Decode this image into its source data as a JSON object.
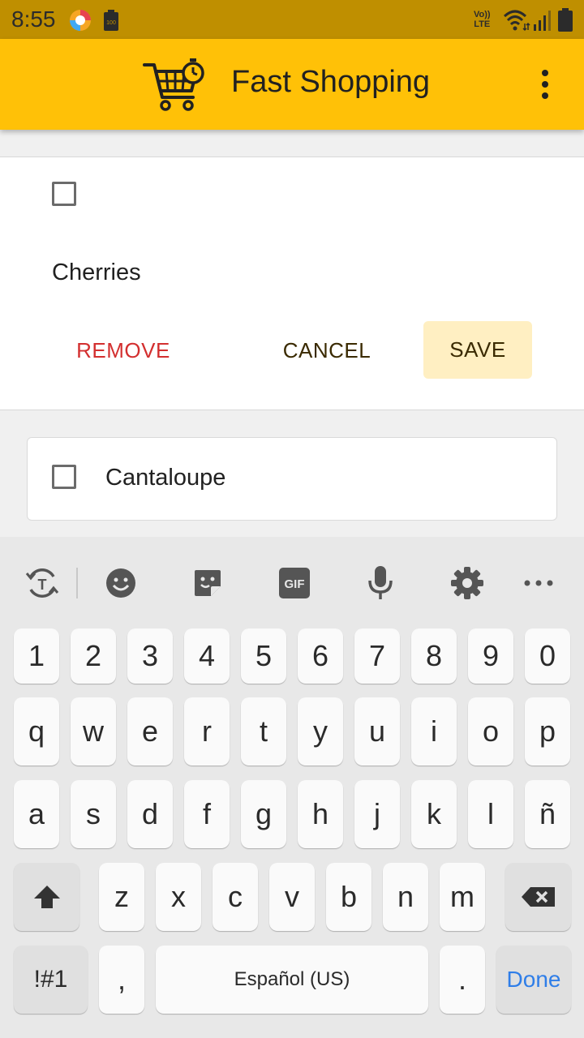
{
  "status_bar": {
    "time": "8:55",
    "volte_top": "Vo))",
    "volte_bottom": "LTE"
  },
  "app_bar": {
    "title": "Fast Shopping",
    "icons": [
      "cart-timer-icon",
      "more-vert-icon"
    ]
  },
  "edit_card": {
    "checked": false,
    "item_name": "Cherries",
    "remove_label": "REMOVE",
    "cancel_label": "CANCEL",
    "save_label": "SAVE"
  },
  "list": {
    "items": [
      {
        "label": "Cantaloupe",
        "checked": false
      }
    ]
  },
  "keyboard": {
    "toolbar_icons": [
      "translate-icon",
      "emoji-icon",
      "sticker-icon",
      "gif-icon",
      "microphone-icon",
      "settings-icon",
      "more-horiz-icon"
    ],
    "gif_label": "GIF",
    "row_numbers": [
      "1",
      "2",
      "3",
      "4",
      "5",
      "6",
      "7",
      "8",
      "9",
      "0"
    ],
    "row_1": [
      "q",
      "w",
      "e",
      "r",
      "t",
      "y",
      "u",
      "i",
      "o",
      "p"
    ],
    "row_2": [
      "a",
      "s",
      "d",
      "f",
      "g",
      "h",
      "j",
      "k",
      "l",
      "ñ"
    ],
    "row_3": [
      "z",
      "x",
      "c",
      "v",
      "b",
      "n",
      "m"
    ],
    "symbols_label": "!#1",
    "comma_label": ",",
    "space_label": "Español (US)",
    "period_label": ".",
    "done_label": "Done"
  },
  "colors": {
    "status_bar": "#bf8f00",
    "app_bar": "#ffc107",
    "remove": "#d32f2f",
    "save_bg": "#ffefc2",
    "done": "#2f7ee8"
  }
}
